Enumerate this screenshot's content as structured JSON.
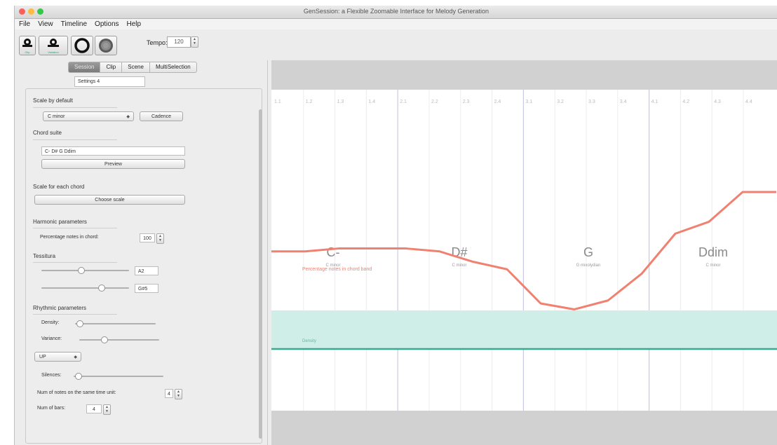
{
  "window": {
    "title": "GenSession: a Flexible Zoomable Interface for Melody Generation",
    "traffic_colors": [
      "#fc605c",
      "#fdbc40",
      "#34c84a"
    ]
  },
  "menu": [
    "File",
    "View",
    "Timeline",
    "Options",
    "Help"
  ],
  "toolbar": {
    "btn1_caption": "Clip",
    "btn2_caption": "Variation",
    "tempo_label": "Tempo:",
    "tempo_value": "120"
  },
  "tabs": [
    "Session",
    "Clip",
    "Scene",
    "MultiSelection"
  ],
  "settings_name": "Settings 4",
  "panel": {
    "scale_default_label": "Scale by default",
    "scale_value": "C minor",
    "cadence_label": "Cadence",
    "chord_suite_label": "Chord suite",
    "chord_suite_value": "C- D# G Ddim",
    "preview_label": "Preview",
    "scale_each_label": "Scale for each chord",
    "choose_scale_label": "Choose scale",
    "harmonic_label": "Harmonic parameters",
    "percentage_label": "Percentage notes in chord:",
    "percentage_value": "100",
    "tessitura_label": "Tessitura",
    "tess_low_value": "A2",
    "tess_high_value": "G#5",
    "tess_low_level": 0.45,
    "tess_high_level": 0.7,
    "rhythmic_label": "Rhythmic parameters",
    "density_label": "Density:",
    "density_level": 0.02,
    "variance_label": "Variance:",
    "variance_level": 0.3,
    "direction_value": "UP",
    "silences_label": "Silences:",
    "silences_level": 0.02,
    "notes_same_label": "Num of notes on the same time unit:",
    "notes_same_value": "4",
    "num_bars_label": "Num of bars:",
    "num_bars_value": "4"
  },
  "timeline": {
    "ticks": [
      "1.1",
      "1.2",
      "1.3",
      "1.4",
      "2.1",
      "2.2",
      "2.3",
      "2.4",
      "3.1",
      "3.2",
      "3.3",
      "3.4",
      "4.1",
      "4.2",
      "4.3",
      "4.4"
    ],
    "chords": [
      {
        "name": "C-",
        "scale": "C minor"
      },
      {
        "name": "D#",
        "scale": "C minor"
      },
      {
        "name": "G",
        "scale": "G mixolydian"
      },
      {
        "name": "Ddim",
        "scale": "C minor"
      }
    ],
    "band_label": "Percentage notes in chord band",
    "density_label": "Density",
    "melody_color": "#f08070",
    "band_color": "#cfeee8",
    "density_line_color": "#3aa88e",
    "melody_points": [
      [
        0,
        0.6
      ],
      [
        1,
        0.6
      ],
      [
        2,
        0.62
      ],
      [
        3,
        0.62
      ],
      [
        4,
        0.62
      ],
      [
        5,
        0.6
      ],
      [
        6,
        0.53
      ],
      [
        7,
        0.48
      ],
      [
        8,
        0.25
      ],
      [
        9,
        0.21
      ],
      [
        10,
        0.27
      ],
      [
        11,
        0.45
      ],
      [
        12,
        0.72
      ],
      [
        13,
        0.8
      ],
      [
        14,
        1.0
      ],
      [
        15,
        1.0
      ]
    ]
  }
}
